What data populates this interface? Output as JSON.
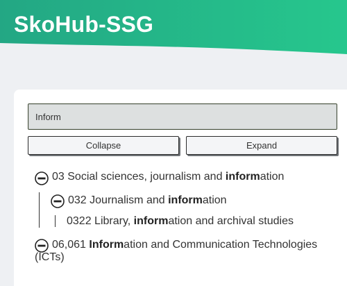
{
  "header": {
    "title": "SkoHub-SSG",
    "gradient_start": "#23a784",
    "gradient_end": "#26c78d"
  },
  "search": {
    "value": "Inform"
  },
  "buttons": {
    "collapse_label": "Collapse",
    "expand_label": "Expand"
  },
  "tree": {
    "items": [
      {
        "prefix": "03 Social sciences, journalism and ",
        "highlight": "inform",
        "suffix": "ation",
        "toggle": "minus-circle-icon"
      },
      {
        "prefix": "032 Journalism and ",
        "highlight": "inform",
        "suffix": "ation",
        "toggle": "minus-circle-icon"
      },
      {
        "prefix": "0322 Library, ",
        "highlight": "inform",
        "suffix": "ation and archival studies"
      },
      {
        "prefix": "06,061 ",
        "highlight": "Inform",
        "suffix": "ation and Communication Technologies",
        "line2": "(ICTs)",
        "toggle": "minus-circle-icon"
      }
    ]
  }
}
